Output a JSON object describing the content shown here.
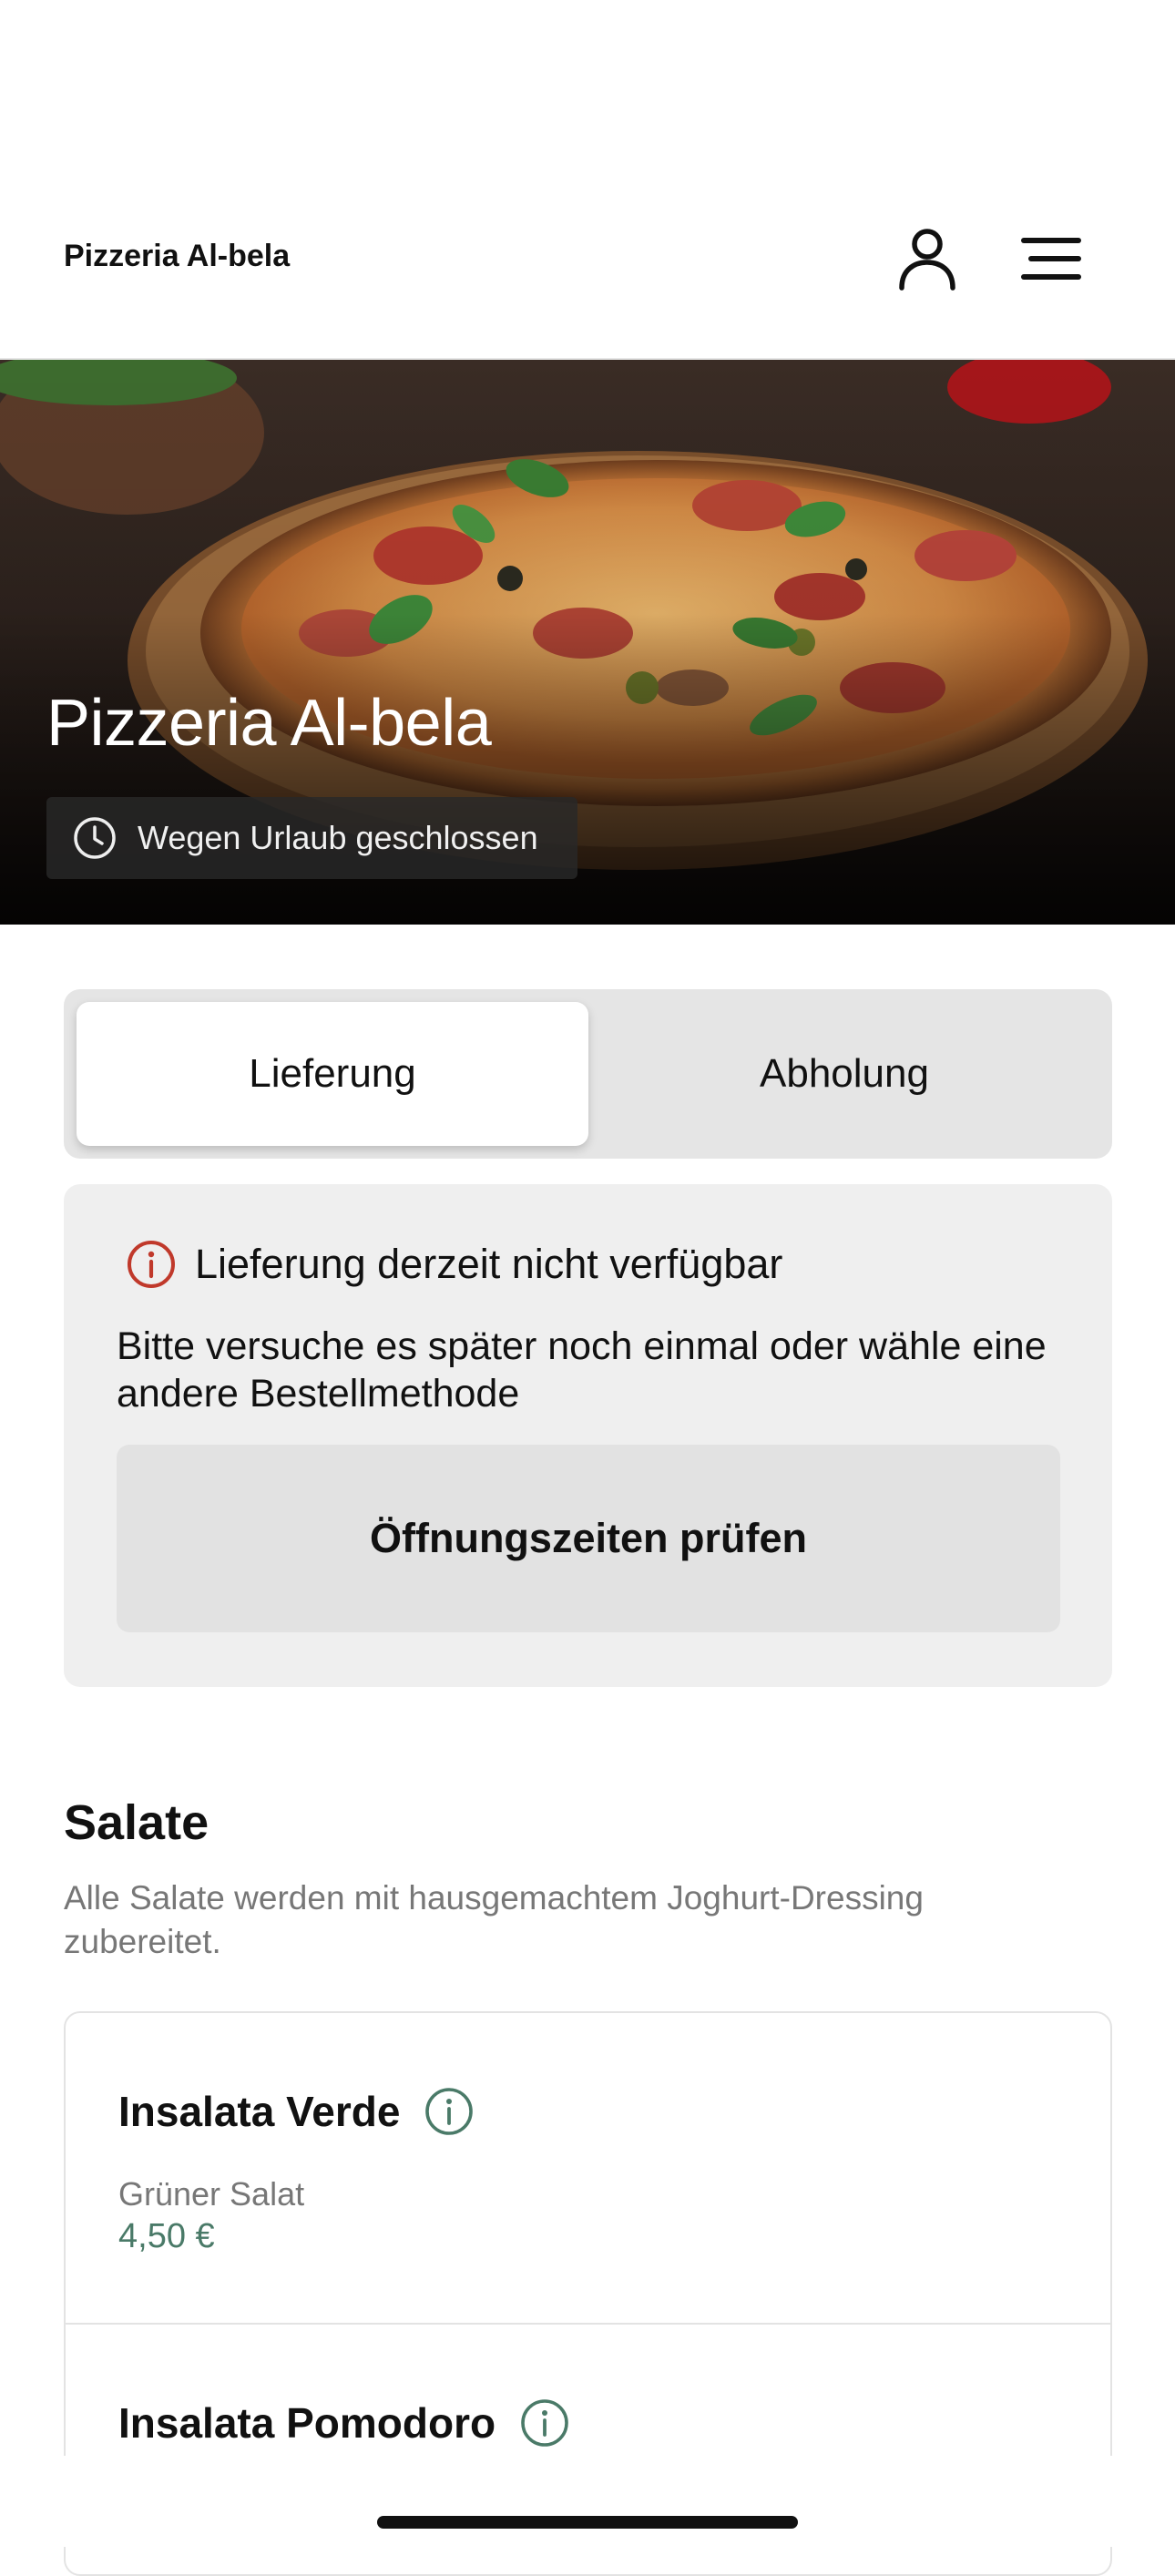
{
  "header": {
    "brand": "Pizzeria Al-bela",
    "account_icon": "person-icon",
    "menu_icon": "hamburger-menu-icon"
  },
  "hero": {
    "title": "Pizzeria Al-bela",
    "status_text": "Wegen Urlaub geschlossen",
    "status_icon": "clock-icon"
  },
  "order_mode": {
    "options": [
      "Lieferung",
      "Abholung"
    ],
    "selected": "Lieferung"
  },
  "notice": {
    "icon": "info-icon",
    "title": "Lieferung derzeit nicht verfügbar",
    "body": "Bitte versuche es später noch einmal oder wähle eine andere Bestellmethode",
    "button_label": "Öffnungszeiten prüfen",
    "icon_color": "#c0392b"
  },
  "section": {
    "title": "Salate",
    "description": "Alle Salate werden mit hausgemachtem Joghurt-Dressing zubereitet."
  },
  "items": [
    {
      "name": "Insalata Verde",
      "description": "Grüner Salat",
      "price": "4,50 €"
    },
    {
      "name": "Insalata Pomodoro"
    }
  ],
  "colors": {
    "accent": "#4a7a68",
    "muted_text": "#777777",
    "card_bg": "#efefef"
  }
}
